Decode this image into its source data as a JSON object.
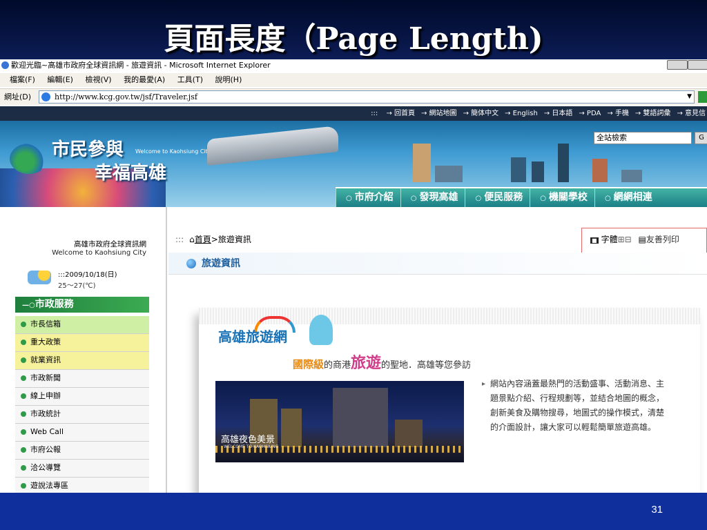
{
  "slide": {
    "title": "頁面長度（Page Length)",
    "page_number": "31"
  },
  "browser": {
    "window_title": "歡迎光臨~高雄市政府全球資訊網 - 旅遊資訊 - Microsoft Internet Explorer",
    "menu": [
      "檔案(F)",
      "編輯(E)",
      "檢視(V)",
      "我的最愛(A)",
      "工具(T)",
      "說明(H)"
    ],
    "address_label": "網址(D)",
    "url": "http://www.kcg.gov.tw/jsf/Traveler.jsf"
  },
  "site": {
    "top_links": [
      "::: ",
      "→ 回首頁",
      "→ 網站地圖",
      "→ 簡体中文",
      "→ English",
      "→ 日本語",
      "→ PDA",
      "→ 手機",
      "→ 雙語詞彙",
      "→ 意見信"
    ],
    "search_placeholder": "全站檢索",
    "search_button": "G",
    "logo_line1": "市民參與",
    "logo_line2": "幸福高雄",
    "logo_sub": "Welcome to Kaohsiung City",
    "main_nav": [
      "市府介紹",
      "發現高雄",
      "便民服務",
      "機關學校",
      "網網相連"
    ]
  },
  "sidebar": {
    "site_name": "高雄市政府全球資訊網",
    "site_name_en": "Welcome to Kaohsiung City",
    "date": ":::2009/10/18(日)",
    "temperature": "25～27(℃)",
    "section_title": "市政服務",
    "items": [
      {
        "label": "市長信箱"
      },
      {
        "label": "重大政策"
      },
      {
        "label": "就業資訊"
      },
      {
        "label": "市政新聞"
      },
      {
        "label": "線上申辦"
      },
      {
        "label": "市政統計"
      },
      {
        "label": "Web Call"
      },
      {
        "label": "市府公報"
      },
      {
        "label": "洽公導覽"
      },
      {
        "label": "遊說法專區"
      }
    ]
  },
  "content": {
    "breadcrumb_dots": ":::",
    "breadcrumb_home": "首頁",
    "breadcrumb_current": ">旅遊資訊",
    "font_size_label": "字體",
    "font_plus": "⊞",
    "font_minus": "⊟",
    "print_label": "友善列印",
    "section_title": "旅遊資訊",
    "tourism_logo": "高雄旅遊網",
    "slogan_part1": "國際級",
    "slogan_part2": "的商港",
    "slogan_part3": "旅遊",
    "slogan_part4": "的聖地．高雄等您參訪",
    "photo_caption": "高雄夜色美景",
    "photo_subcaption": "WELCOME TO KAOHSIUNG",
    "description": "網站內容涵蓋最熱門的活動盛事、活動消息、主題景點介紹、行程規劃等，並結合地圖的概念，創新美食及購物搜尋，地圖式的操作模式，清楚的介面設計，讓大家可以輕鬆簡單旅遊高雄。"
  }
}
